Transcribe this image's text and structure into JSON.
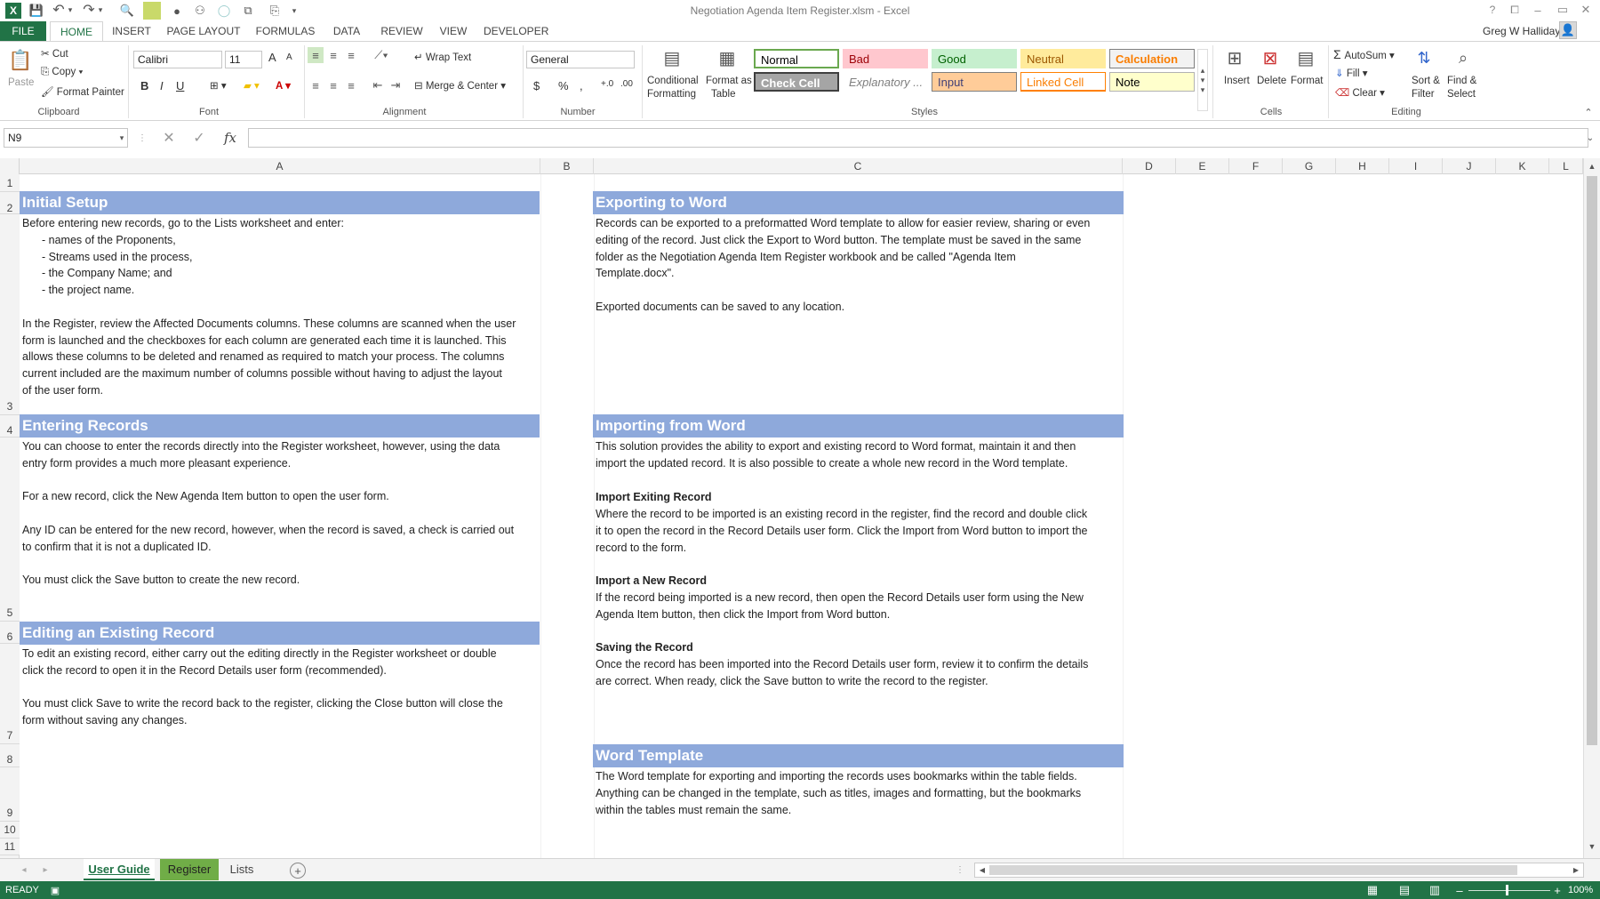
{
  "window": {
    "title": "Negotiation Agenda Item Register.xlsm - Excel",
    "user": "Greg W Halliday",
    "help": "?",
    "min": "–",
    "max": "▭",
    "close": "✕"
  },
  "qat": {
    "undo": "↶",
    "redo": "↷",
    "more": "▾"
  },
  "tabs": [
    "FILE",
    "HOME",
    "INSERT",
    "PAGE LAYOUT",
    "FORMULAS",
    "DATA",
    "REVIEW",
    "VIEW",
    "DEVELOPER"
  ],
  "ribbon": {
    "clipboard": {
      "paste": "Paste",
      "cut": "Cut",
      "copy": "Copy",
      "format_painter": "Format Painter",
      "label": "Clipboard"
    },
    "font": {
      "name": "Calibri",
      "size": "11",
      "bold": "B",
      "italic": "I",
      "underline": "U",
      "label": "Font",
      "grow": "A",
      "shrink": "A"
    },
    "alignment": {
      "wrap": "Wrap Text",
      "merge": "Merge & Center",
      "label": "Alignment"
    },
    "number": {
      "format": "General",
      "currency": "$",
      "percent": "%",
      "comma": ",",
      "label": "Number"
    },
    "styles": {
      "conditional": "Conditional",
      "conditional2": "Formatting",
      "format_table": "Format as",
      "format_table2": "Table",
      "label": "Styles",
      "cells": [
        {
          "name": "Normal",
          "bg": "#ffffff",
          "fg": "#000000",
          "border": "#6aa84f"
        },
        {
          "name": "Bad",
          "bg": "#ffc7ce",
          "fg": "#9c0006",
          "border": "#ffc7ce"
        },
        {
          "name": "Good",
          "bg": "#c6efce",
          "fg": "#006100",
          "border": "#c6efce"
        },
        {
          "name": "Neutral",
          "bg": "#ffeb9c",
          "fg": "#9c5700",
          "border": "#ffeb9c"
        },
        {
          "name": "Calculation",
          "bg": "#f2f2f2",
          "fg": "#fa7d00",
          "border": "#7f7f7f"
        },
        {
          "name": "Check Cell",
          "bg": "#a5a5a5",
          "fg": "#ffffff",
          "border": "#3f3f3f"
        },
        {
          "name": "Explanatory ...",
          "bg": "#ffffff",
          "fg": "#7f7f7f",
          "border": "#ffffff"
        },
        {
          "name": "Input",
          "bg": "#ffcc99",
          "fg": "#3f3f76",
          "border": "#7f7f7f"
        },
        {
          "name": "Linked Cell",
          "bg": "#ffffff",
          "fg": "#fa7d00",
          "border": "#ff8001"
        },
        {
          "name": "Note",
          "bg": "#ffffcc",
          "fg": "#000000",
          "border": "#b2b2b2"
        }
      ]
    },
    "cells": {
      "insert": "Insert",
      "delete": "Delete",
      "format": "Format",
      "label": "Cells"
    },
    "editing": {
      "autosum": "AutoSum",
      "fill": "Fill",
      "clear": "Clear",
      "sort": "Sort &",
      "sort2": "Filter",
      "find": "Find &",
      "find2": "Select",
      "label": "Editing"
    }
  },
  "formula_bar": {
    "name_box": "N9",
    "fx": "fx",
    "value": ""
  },
  "columns": [
    "A",
    "B",
    "C",
    "D",
    "E",
    "F",
    "G",
    "H",
    "I",
    "J",
    "K",
    "L"
  ],
  "rows": [
    "1",
    "2",
    "3",
    "4",
    "5",
    "6",
    "7",
    "8",
    "9",
    "10",
    "11"
  ],
  "sections": {
    "initial_setup": {
      "title": "Initial Setup",
      "lines": [
        "Before entering new records, go to the Lists worksheet and enter:",
        "- names of the Proponents,",
        "- Streams used in the process,",
        "- the Company Name; and",
        "- the project name.",
        "",
        "In the Register, review the Affected Documents columns. These columns are scanned when the user",
        "form is launched and the checkboxes for each column are generated each time it is launched. This",
        "allows these columns to be deleted and renamed as required to match your process. The columns",
        "current included are the maximum number of columns possible without having to adjust the layout",
        "of the user form."
      ]
    },
    "entering_records": {
      "title": "Entering Records",
      "lines": [
        "You can choose to enter the records directly into the Register worksheet, however, using the data",
        "entry form provides a much more pleasant experience.",
        "",
        "For a new record, click the New Agenda Item button to open the user form.",
        "",
        "Any ID can be entered for the new record, however, when the record is saved, a check is carried out",
        "to confirm that it is not a duplicated ID.",
        "",
        "You must click the Save button to create the new record."
      ]
    },
    "editing_record": {
      "title": "Editing an Existing Record",
      "lines": [
        "To edit an existing record, either carry out the editing directly in the Register worksheet or double",
        "click the record to open it in the Record Details user form (recommended).",
        "",
        "You must click Save to write the record back to the register, clicking the Close button will close the",
        "form without saving any changes."
      ]
    },
    "exporting": {
      "title": "Exporting to Word",
      "lines": [
        "Records can be exported to a preformatted Word template to allow for easier review, sharing or even",
        "editing of the record. Just click the Export to Word button. The template must be saved in the same",
        "folder as the Negotiation Agenda Item Register workbook and be called \"Agenda Item",
        "Template.docx\".",
        "",
        "Exported documents can be saved to any location."
      ]
    },
    "importing": {
      "title": "Importing from Word",
      "lines": [
        "This solution provides the ability to export and existing record to Word format, maintain it and then",
        "import the updated record. It is also possible to create a whole new record in the Word template."
      ],
      "sub1": {
        "title": "Import Exiting Record",
        "lines": [
          "Where the record to be imported is an existing record in the register, find the record and double click",
          "it to open the record in the Record Details user form. Click the Import from Word button to import the",
          "record to the form."
        ]
      },
      "sub2": {
        "title": "Import a New Record",
        "lines": [
          "If the record being imported is a new record, then open the Record Details user form using the New",
          "Agenda Item button, then click the Import from Word button."
        ]
      },
      "sub3": {
        "title": "Saving the Record",
        "lines": [
          "Once the record has been imported into the Record Details user form, review it to confirm the details",
          "are correct. When ready, click the Save button to write the record to the register."
        ]
      }
    },
    "word_template": {
      "title": "Word Template",
      "lines": [
        "The Word template for exporting and importing the records uses bookmarks within the table fields.",
        "Anything can be changed in the template, such as titles, images and formatting, but the bookmarks",
        "within the tables must remain the same."
      ]
    }
  },
  "sheets": [
    {
      "name": "User Guide",
      "active": true
    },
    {
      "name": "Register",
      "active": false
    },
    {
      "name": "Lists",
      "active": false
    }
  ],
  "add_sheet": "+",
  "status": {
    "mode": "READY",
    "zoom": "100%"
  },
  "colors": {
    "header_band": "#8ea9db",
    "excel_green": "#217346",
    "register_tab": "#70ad47"
  }
}
